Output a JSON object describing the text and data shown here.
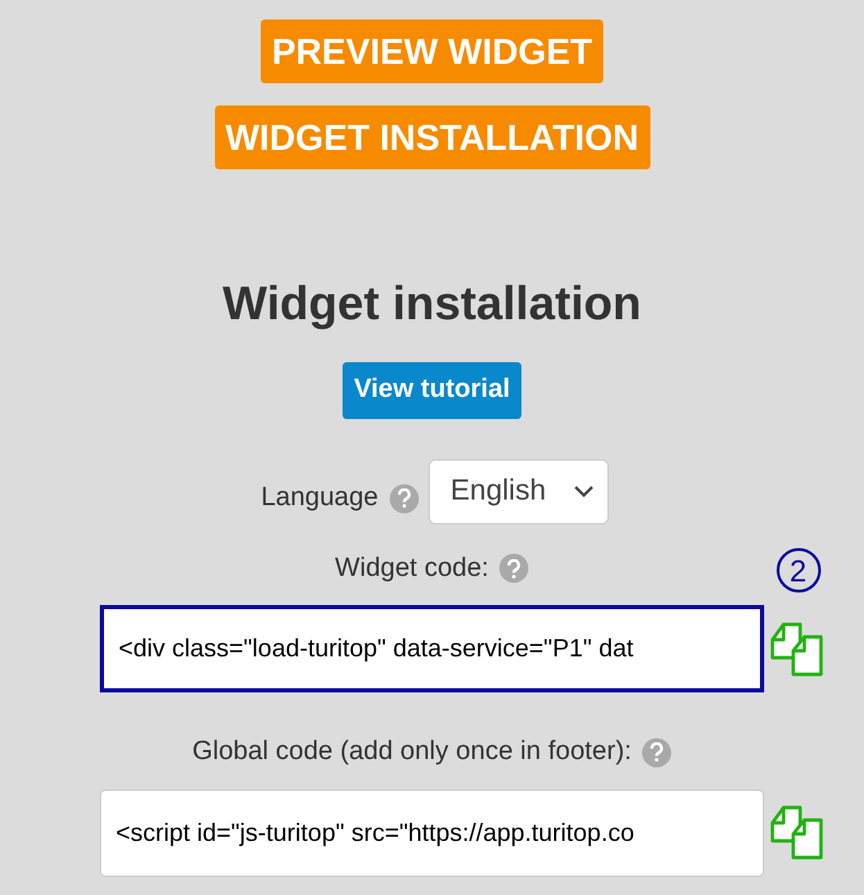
{
  "buttons": [
    {
      "label": "PREVIEW WIDGET"
    },
    {
      "label": "WIDGET INSTALLATION"
    }
  ],
  "heading": "Widget installation",
  "tutorial_button": "View tutorial",
  "language": {
    "label": "Language",
    "value": "English"
  },
  "code_fields": [
    {
      "label": "Widget code:",
      "value": "<div class=\"load-turitop\" data-service=\"P1\" dat",
      "highlighted": true,
      "marker": "2"
    },
    {
      "label": "Global code (add only once in footer):",
      "value": "<script id=\"js-turitop\" src=\"https://app.turitop.co",
      "highlighted": false
    }
  ]
}
